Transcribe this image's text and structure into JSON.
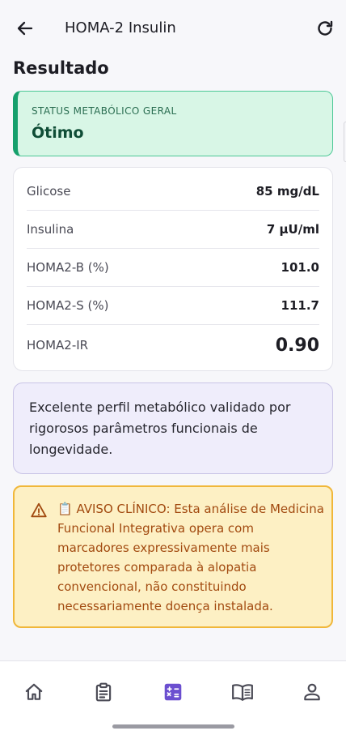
{
  "app_bar": {
    "title": "HOMA-2 Insulin",
    "back_icon": "arrow-left-icon",
    "refresh_icon": "refresh-icon"
  },
  "section": {
    "title": "Resultado"
  },
  "status": {
    "label": "STATUS METABÓLICO GERAL",
    "value": "Ótimo",
    "accent_color": "#16a06c"
  },
  "metrics": [
    {
      "label": "Glicose",
      "value": "85 mg/dL"
    },
    {
      "label": "Insulina",
      "value": "7 µU/ml"
    },
    {
      "label": "HOMA2-B (%)",
      "value": "101.0"
    },
    {
      "label": "HOMA2-S (%)",
      "value": "111.7"
    },
    {
      "label": "HOMA2-IR",
      "value": "0.90"
    }
  ],
  "interpretation": {
    "text": "Excelente perfil metabólico validado por rigorosos parâmetros funcionais de longevidade."
  },
  "clinical_warning": {
    "icon": "warning-icon",
    "text": "📋 AVISO CLÍNICO: Esta análise de Medicina Funcional Integrativa opera com marcadores expressivamente mais protetores comparada à alopatia convencional, não constituindo necessariamente doença instalada.",
    "color": "#a24a10"
  },
  "bottom_nav": {
    "items": [
      {
        "icon": "home-icon"
      },
      {
        "icon": "clipboard-icon"
      },
      {
        "icon": "calculator-icon",
        "active": true
      },
      {
        "icon": "book-icon"
      },
      {
        "icon": "person-icon"
      }
    ],
    "active_color": "#6b4fd0"
  }
}
